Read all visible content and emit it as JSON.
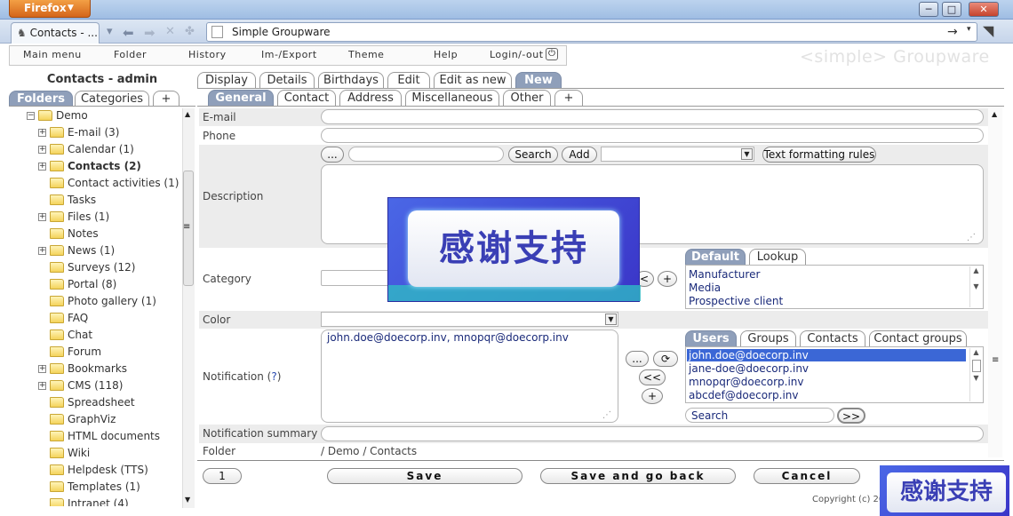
{
  "browser": {
    "firefox_label": "Firefox",
    "tab_title": "Contacts - ...",
    "url_title": "Simple Groupware",
    "window_buttons": [
      "─",
      "□",
      "✕"
    ]
  },
  "menu": {
    "items": [
      "Main menu",
      "Folder",
      "History",
      "Im-/Export",
      "Theme",
      "Help",
      "Login/-out"
    ],
    "brand": "<simple> Groupware"
  },
  "sidebar": {
    "title": "Contacts - admin",
    "tabs": [
      "Folders",
      "Categories",
      "+"
    ],
    "tree": [
      {
        "label": "Demo",
        "level": 0,
        "exp": "minus"
      },
      {
        "label": "E-mail (3)",
        "level": 1,
        "exp": "plus"
      },
      {
        "label": "Calendar (1)",
        "level": 1,
        "exp": "plus"
      },
      {
        "label": "Contacts (2)",
        "level": 1,
        "exp": "plus",
        "bold": true
      },
      {
        "label": "Contact activities (1)",
        "level": 1,
        "exp": ""
      },
      {
        "label": "Tasks",
        "level": 1,
        "exp": ""
      },
      {
        "label": "Files (1)",
        "level": 1,
        "exp": "plus"
      },
      {
        "label": "Notes",
        "level": 1,
        "exp": ""
      },
      {
        "label": "News (1)",
        "level": 1,
        "exp": "plus"
      },
      {
        "label": "Surveys (12)",
        "level": 1,
        "exp": ""
      },
      {
        "label": "Portal (8)",
        "level": 1,
        "exp": ""
      },
      {
        "label": "Photo gallery (1)",
        "level": 1,
        "exp": ""
      },
      {
        "label": "FAQ",
        "level": 1,
        "exp": ""
      },
      {
        "label": "Chat",
        "level": 1,
        "exp": ""
      },
      {
        "label": "Forum",
        "level": 1,
        "exp": ""
      },
      {
        "label": "Bookmarks",
        "level": 1,
        "exp": "plus"
      },
      {
        "label": "CMS (118)",
        "level": 1,
        "exp": "plus"
      },
      {
        "label": "Spreadsheet",
        "level": 1,
        "exp": ""
      },
      {
        "label": "GraphViz",
        "level": 1,
        "exp": ""
      },
      {
        "label": "HTML documents",
        "level": 1,
        "exp": ""
      },
      {
        "label": "Wiki",
        "level": 1,
        "exp": ""
      },
      {
        "label": "Helpdesk (TTS)",
        "level": 1,
        "exp": ""
      },
      {
        "label": "Templates (1)",
        "level": 1,
        "exp": ""
      },
      {
        "label": "Intranet (4)",
        "level": 1,
        "exp": ""
      }
    ]
  },
  "view_tabs": [
    "Display",
    "Details",
    "Birthdays",
    "Edit",
    "Edit as new",
    "New"
  ],
  "form_tabs": [
    "General",
    "Contact",
    "Address",
    "Miscellaneous",
    "Other",
    "+"
  ],
  "form": {
    "email_label": "E-mail",
    "phone_label": "Phone",
    "description_label": "Description",
    "desc_toolbar": {
      "dots": "...",
      "search": "Search",
      "add": "Add",
      "rules": "Text formatting rules"
    },
    "category_label": "Category",
    "category_buttons": {
      "left": "<",
      "plus": "+"
    },
    "category_tabs": [
      "Default",
      "Lookup"
    ],
    "category_options": [
      "Manufacturer",
      "Media",
      "Prospective client"
    ],
    "color_label": "Color",
    "notification_label": "Notification (",
    "notification_help": "?",
    "notification_close": ")",
    "notification_value": "john.doe@doecorp.inv, mnopqr@doecorp.inv",
    "notif_buttons": {
      "dots": "...",
      "refresh": "⟳",
      "back": "<<",
      "plus": "+"
    },
    "notif_tabs": [
      "Users",
      "Groups",
      "Contacts",
      "Contact groups"
    ],
    "users": [
      "john.doe@doecorp.inv",
      "jane-doe@doecorp.inv",
      "mnopqr@doecorp.inv",
      "abcdef@doecorp.inv"
    ],
    "user_search_value": "Search",
    "user_search_go": ">>",
    "summary_label": "Notification summary",
    "folder_label": "Folder",
    "folder_value": "/ Demo / Contacts"
  },
  "actions": {
    "page": "1",
    "save": "Save",
    "save_back": "Save and go back",
    "cancel": "Cancel"
  },
  "footer": {
    "copyright": "Copyright (c) 20"
  },
  "watermark": {
    "text": "感谢支持"
  }
}
